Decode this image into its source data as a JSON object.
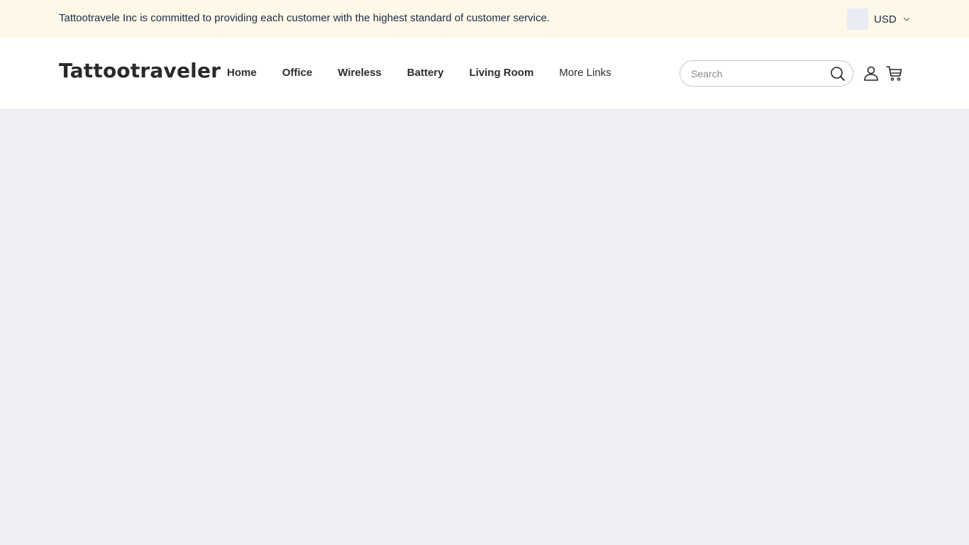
{
  "announcement": {
    "text": "Tattootravele Inc is committed to providing each customer with the highest standard of customer service."
  },
  "currency": {
    "code": "USD",
    "chevron_icon": "chevron-down-icon"
  },
  "header": {
    "logo": "Tattootraveler",
    "nav": [
      {
        "label": "Home"
      },
      {
        "label": "Office"
      },
      {
        "label": "Wireless"
      },
      {
        "label": "Battery"
      },
      {
        "label": "Living Room"
      },
      {
        "label": "More Links"
      }
    ],
    "search": {
      "placeholder": "Search",
      "value": ""
    },
    "icons": {
      "search": "search-icon",
      "account": "account-icon",
      "cart": "cart-icon"
    }
  },
  "colors": {
    "announcement_bg": "#fdf8e8",
    "page_bg": "#eeeff4",
    "header_bg": "#ffffff",
    "text": "#1d2a44"
  }
}
